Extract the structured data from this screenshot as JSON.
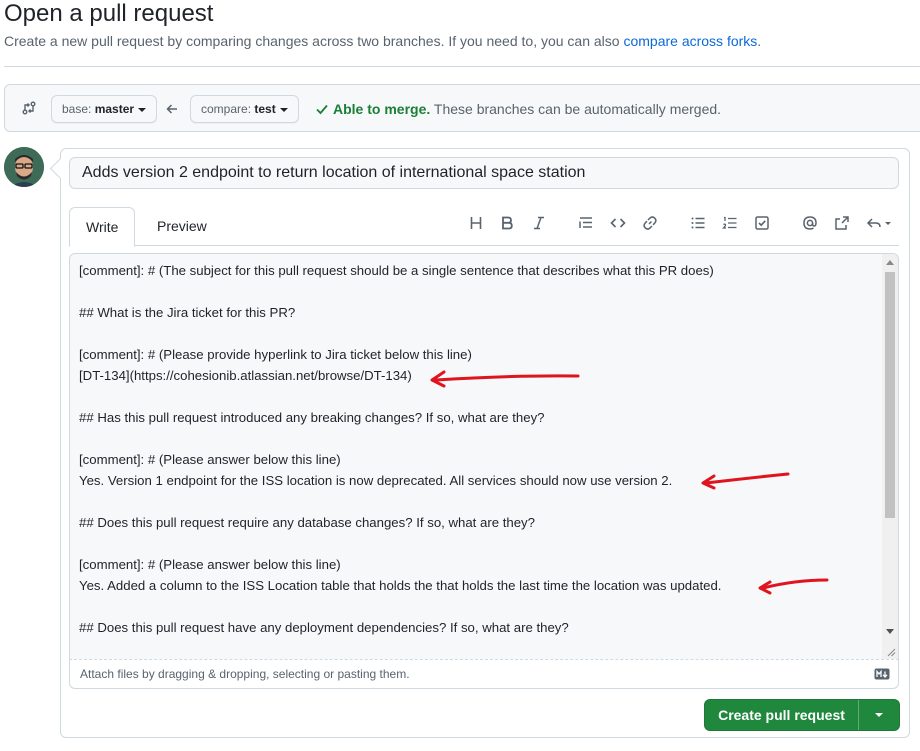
{
  "header": {
    "title": "Open a pull request",
    "subtitle": "Create a new pull request by comparing changes across two branches. If you need to, you can also",
    "subtitle_link": "compare across forks",
    "subtitle_end": "."
  },
  "range": {
    "base_prefix": "base:",
    "base_branch": "master",
    "compare_prefix": "compare:",
    "compare_branch": "test",
    "merge_ok": "Able to merge.",
    "merge_text": "These branches can be automatically merged."
  },
  "pr": {
    "title_value": "Adds version 2 endpoint to return location of international space station"
  },
  "tabs": [
    {
      "label": "Write",
      "active": true
    },
    {
      "label": "Preview",
      "active": false
    }
  ],
  "toolbar": [
    "heading-icon",
    "bold-icon",
    "italic-icon",
    "quote-icon",
    "code-icon",
    "link-icon",
    "unordered-list-icon",
    "ordered-list-icon",
    "task-list-icon",
    "mention-icon",
    "reference-icon",
    "reply-icon"
  ],
  "body_lines": [
    "[comment]: # (The subject for this pull request should be a single sentence that describes what this PR does)",
    "",
    "## What is the Jira ticket for this PR?",
    "",
    "[comment]: # (Please provide hyperlink to Jira ticket below this line)",
    "[DT-134](https://cohesionib.atlassian.net/browse/DT-134)",
    "",
    "## Has this pull request introduced any breaking changes? If so, what are they?",
    "",
    "[comment]: # (Please answer below this line)",
    "Yes. Version 1 endpoint for the ISS location is now deprecated. All services should now use version 2.",
    "",
    "## Does this pull request require any database changes? If so, what are they?",
    "",
    "[comment]: # (Please answer below this line)",
    "Yes. Added a column to the ISS Location table that holds the that holds the last time the location was updated.",
    "",
    "## Does this pull request have any deployment dependencies? If so, what are they?"
  ],
  "attach": {
    "text": "Attach files by dragging & dropping, selecting or pasting them."
  },
  "actions": {
    "create_label": "Create pull request"
  },
  "colors": {
    "accent_green": "#1f883d",
    "link_blue": "#0969da",
    "annotation_red": "#e0141e"
  }
}
